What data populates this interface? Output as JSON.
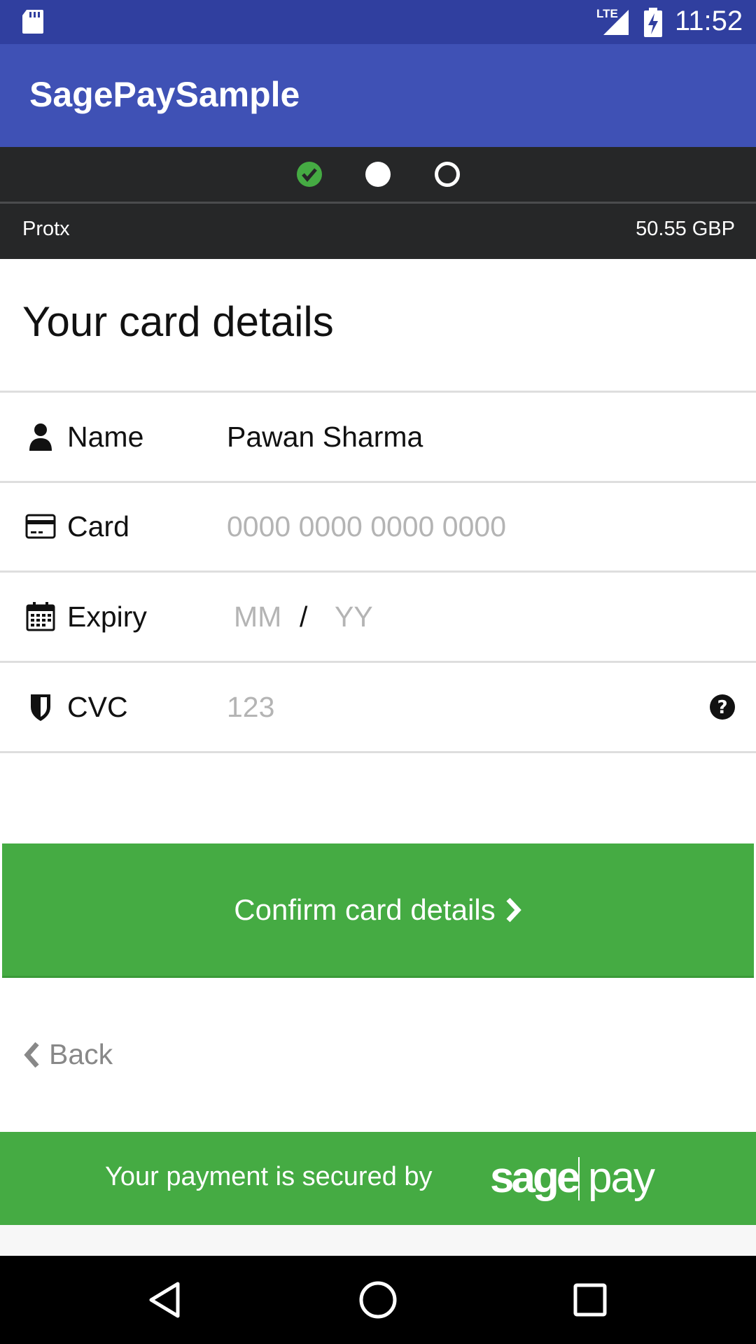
{
  "status_bar": {
    "network": "LTE",
    "time": "11:52"
  },
  "app_bar": {
    "title": "SagePaySample"
  },
  "steps": [
    {
      "state": "done",
      "icon": "check-circle-icon"
    },
    {
      "state": "current",
      "icon": "filled-circle-icon"
    },
    {
      "state": "pending",
      "icon": "empty-circle-icon"
    }
  ],
  "merchant": {
    "name": "Protx",
    "amount": "50.55 GBP"
  },
  "form": {
    "heading": "Your card details",
    "name": {
      "label": "Name",
      "value": "Pawan Sharma",
      "icon": "person-icon"
    },
    "card": {
      "label": "Card",
      "placeholder": "0000 0000 0000 0000",
      "icon": "credit-card-icon"
    },
    "expiry": {
      "label": "Expiry",
      "month_placeholder": "MM",
      "separator": "/",
      "year_placeholder": "YY",
      "icon": "calendar-icon"
    },
    "cvc": {
      "label": "CVC",
      "placeholder": "123",
      "icon": "shield-icon",
      "help_icon": "question-circle-icon"
    }
  },
  "actions": {
    "confirm_label": "Confirm card details",
    "back_label": "Back"
  },
  "footer": {
    "text": "Your payment is secured by",
    "logo_left": "sage",
    "logo_right": "pay"
  },
  "colors": {
    "status_bar": "#303f9f",
    "app_bar": "#3f51b5",
    "accent_green": "#45ab43",
    "dark_bar": "#262728"
  }
}
